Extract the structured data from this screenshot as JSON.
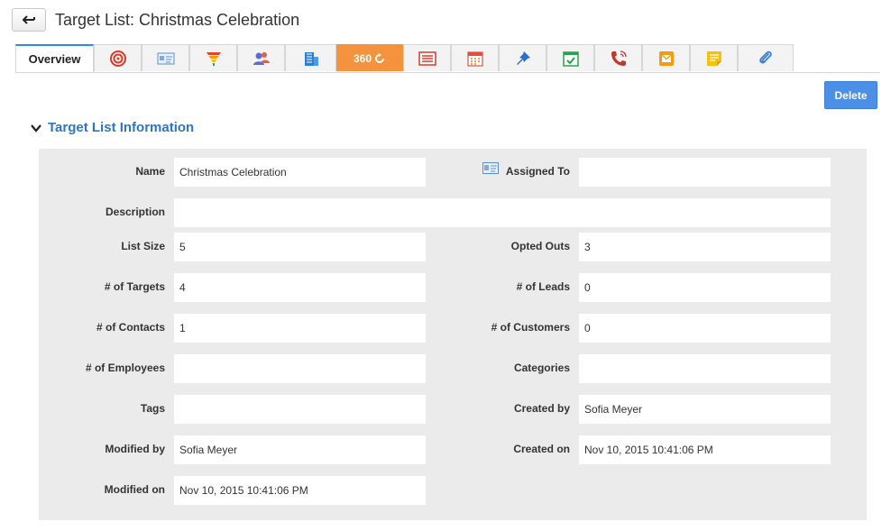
{
  "header": {
    "title": "Target List: Christmas Celebration"
  },
  "tabs": [
    {
      "label": "Overview",
      "icon": "overview"
    },
    {
      "icon": "target-icon"
    },
    {
      "icon": "contact-card-icon"
    },
    {
      "icon": "funnel-icon"
    },
    {
      "icon": "users-icon"
    },
    {
      "icon": "building-icon"
    },
    {
      "label": "360",
      "icon": "360-refresh-icon",
      "color": "#f5923e"
    },
    {
      "icon": "list-icon"
    },
    {
      "icon": "calendar-icon"
    },
    {
      "icon": "pin-icon"
    },
    {
      "icon": "task-check-icon"
    },
    {
      "icon": "phone-icon"
    },
    {
      "icon": "mail-icon"
    },
    {
      "icon": "note-icon"
    },
    {
      "icon": "attachment-icon"
    }
  ],
  "actions": {
    "delete": "Delete"
  },
  "section": {
    "title": "Target List Information"
  },
  "fields": {
    "name": {
      "label": "Name",
      "value": "Christmas Celebration"
    },
    "assigned_to": {
      "label": "Assigned To",
      "value": ""
    },
    "description": {
      "label": "Description",
      "value": ""
    },
    "list_size": {
      "label": "List Size",
      "value": "5"
    },
    "opted_outs": {
      "label": "Opted Outs",
      "value": "3"
    },
    "targets": {
      "label": "# of Targets",
      "value": "4"
    },
    "leads": {
      "label": "# of Leads",
      "value": "0"
    },
    "contacts": {
      "label": "# of Contacts",
      "value": "1"
    },
    "customers": {
      "label": "# of Customers",
      "value": "0"
    },
    "employees": {
      "label": "# of Employees",
      "value": ""
    },
    "categories": {
      "label": "Categories",
      "value": ""
    },
    "tags": {
      "label": "Tags",
      "value": ""
    },
    "created_by": {
      "label": "Created by",
      "value": "Sofia Meyer"
    },
    "modified_by": {
      "label": "Modified by",
      "value": "Sofia Meyer"
    },
    "created_on": {
      "label": "Created on",
      "value": "Nov 10, 2015 10:41:06 PM"
    },
    "modified_on": {
      "label": "Modified on",
      "value": "Nov 10, 2015 10:41:06 PM"
    }
  },
  "colors": {
    "accent": "#2e75c6",
    "delete": "#4b90e6",
    "tab360": "#f5923e"
  }
}
